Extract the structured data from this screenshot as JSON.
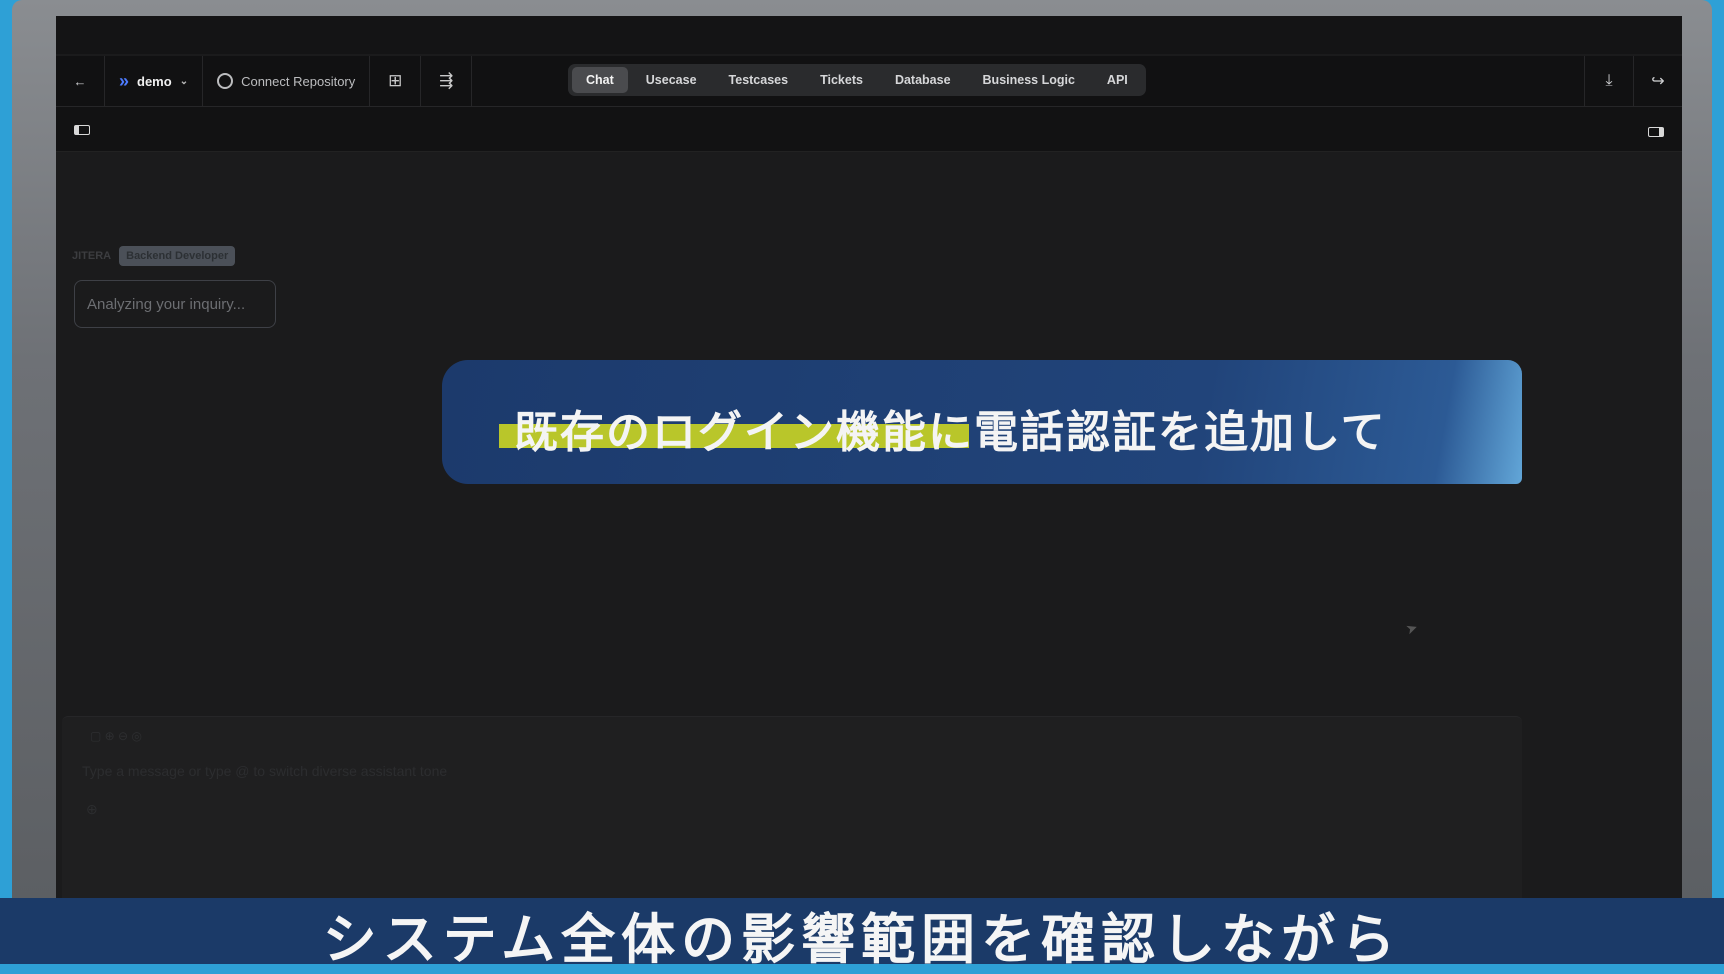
{
  "toolbar": {
    "project_name": "demo",
    "connect_repo_label": "Connect Repository",
    "tabs": [
      "Chat",
      "Usecase",
      "Testcases",
      "Tickets",
      "Database",
      "Business Logic",
      "API"
    ],
    "active_tab": "Chat"
  },
  "chat": {
    "agent_name": "JITERA",
    "agent_role": "Backend Developer",
    "status_message": "Analyzing your inquiry...",
    "input_placeholder": "Type a message or type @ to switch diverse assistant tone"
  },
  "overlay": {
    "highlighted_text": "既存のログイン機能",
    "rest_text": "に電話認証を追加して",
    "highlight_color": "#b9c62a",
    "banner_color": "#1c3a6c"
  },
  "subtitle": {
    "text": "システム全体の影響範囲を確認しながら",
    "bar_color": "#1b3a68"
  }
}
